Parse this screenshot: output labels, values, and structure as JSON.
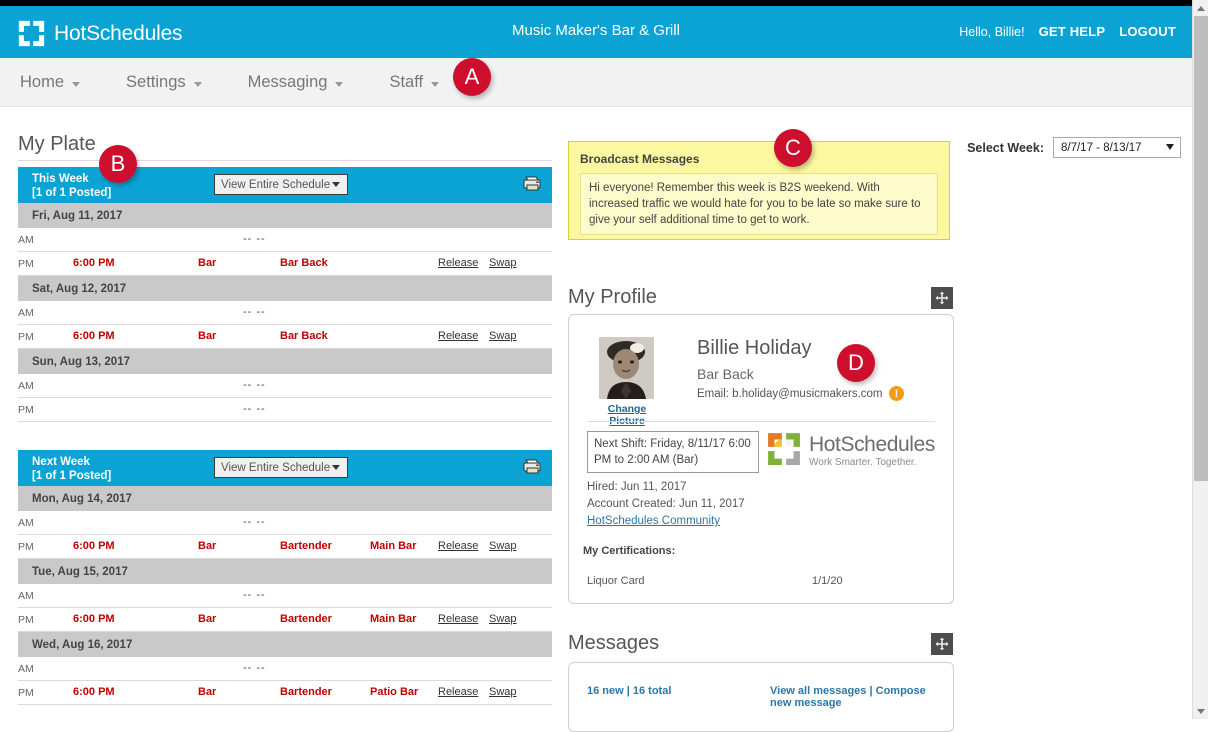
{
  "header": {
    "brand": "HotSchedules",
    "brand_logo_icon": "hotschedules-pinwheel-icon",
    "site_title": "Music Maker's Bar & Grill",
    "hello": "Hello, Billie!",
    "get_help": "GET HELP",
    "logout": "LOGOUT",
    "bg_color": "#0ba3d4"
  },
  "nav": {
    "items": [
      {
        "label": "Home",
        "caret": "chevron-down-icon"
      },
      {
        "label": "Settings",
        "caret": "chevron-down-icon"
      },
      {
        "label": "Messaging",
        "caret": "chevron-down-icon"
      },
      {
        "label": "Staff",
        "caret": "chevron-down-icon"
      }
    ]
  },
  "badges": {
    "a": "A",
    "b": "B",
    "c": "C",
    "d": "D",
    "color": "#ce0e2d"
  },
  "my_plate": {
    "title": "My Plate",
    "select_week_label": "Select Week:",
    "select_week_value": "8/7/17 - 8/13/17",
    "weeks": [
      {
        "title": "This Week",
        "posted": "[1 of 1 Posted]",
        "view_select": "View Entire Schedule",
        "print_icon": "printer-icon",
        "days": [
          {
            "date": "Fri, Aug 11, 2017",
            "rows": [
              {
                "ap": "AM",
                "time": "",
                "dash": "-- --",
                "schedule": "",
                "job": "",
                "location": "",
                "release": "",
                "swap": ""
              },
              {
                "ap": "PM",
                "time": "6:00 PM",
                "dash": "",
                "schedule": "Bar",
                "job": "Bar Back",
                "location": "",
                "release": "Release",
                "swap": "Swap"
              }
            ]
          },
          {
            "date": "Sat, Aug 12, 2017",
            "rows": [
              {
                "ap": "AM",
                "time": "",
                "dash": "-- --",
                "schedule": "",
                "job": "",
                "location": "",
                "release": "",
                "swap": ""
              },
              {
                "ap": "PM",
                "time": "6:00 PM",
                "dash": "",
                "schedule": "Bar",
                "job": "Bar Back",
                "location": "",
                "release": "Release",
                "swap": "Swap"
              }
            ]
          },
          {
            "date": "Sun, Aug 13, 2017",
            "rows": [
              {
                "ap": "AM",
                "time": "",
                "dash": "-- --",
                "schedule": "",
                "job": "",
                "location": "",
                "release": "",
                "swap": ""
              },
              {
                "ap": "PM",
                "time": "",
                "dash": "-- --",
                "schedule": "",
                "job": "",
                "location": "",
                "release": "",
                "swap": ""
              }
            ]
          }
        ]
      },
      {
        "title": "Next Week",
        "posted": "[1 of 1 Posted]",
        "view_select": "View Entire Schedule",
        "print_icon": "printer-icon",
        "days": [
          {
            "date": "Mon, Aug 14, 2017",
            "rows": [
              {
                "ap": "AM",
                "time": "",
                "dash": "-- --",
                "schedule": "",
                "job": "",
                "location": "",
                "release": "",
                "swap": ""
              },
              {
                "ap": "PM",
                "time": "6:00 PM",
                "dash": "",
                "schedule": "Bar",
                "job": "Bartender",
                "location": "Main Bar",
                "release": "Release",
                "swap": "Swap"
              }
            ]
          },
          {
            "date": "Tue, Aug 15, 2017",
            "rows": [
              {
                "ap": "AM",
                "time": "",
                "dash": "-- --",
                "schedule": "",
                "job": "",
                "location": "",
                "release": "",
                "swap": ""
              },
              {
                "ap": "PM",
                "time": "6:00 PM",
                "dash": "",
                "schedule": "Bar",
                "job": "Bartender",
                "location": "Main Bar",
                "release": "Release",
                "swap": "Swap"
              }
            ]
          },
          {
            "date": "Wed, Aug 16, 2017",
            "rows": [
              {
                "ap": "AM",
                "time": "",
                "dash": "-- --",
                "schedule": "",
                "job": "",
                "location": "",
                "release": "",
                "swap": ""
              },
              {
                "ap": "PM",
                "time": "6:00 PM",
                "dash": "",
                "schedule": "Bar",
                "job": "Bartender",
                "location": "Patio Bar",
                "release": "Release",
                "swap": "Swap"
              }
            ]
          }
        ]
      }
    ]
  },
  "broadcast": {
    "title": "Broadcast Messages",
    "body": "Hi everyone! Remember this week is B2S weekend. With increased traffic we would hate for you to be late so make sure to give your self additional time to get to work."
  },
  "profile": {
    "panel_title": "My Profile",
    "move_icon": "move-handle-icon",
    "avatar_icon": "user-avatar-photo",
    "change_picture": "Change Picture",
    "name": "Billie Holiday",
    "job": "Bar Back",
    "email": "Email: b.holiday@musicmakers.com",
    "warning_icon": "warning-icon",
    "next_shift": "Next Shift: Friday, 8/11/17 6:00 PM to 2:00 AM (Bar)",
    "logo_main": "HotSchedules",
    "logo_sub": "Work Smarter. Together.",
    "hired": "Hired: Jun 11, 2017",
    "account_created": "Account Created: Jun 11, 2017",
    "community_link": "HotSchedules Community",
    "certifications_title": "My Certifications:",
    "certifications": [
      {
        "name": "Liquor Card",
        "date": "1/1/20"
      }
    ]
  },
  "messages": {
    "panel_title": "Messages",
    "move_icon": "move-handle-icon",
    "counts": "16 new | 16 total",
    "view_all": "View all messages",
    "separator": " | ",
    "compose": "Compose new message"
  },
  "scrollbar": {
    "up_icon": "scroll-up-arrow-icon",
    "down_icon": "scroll-down-arrow-icon"
  }
}
